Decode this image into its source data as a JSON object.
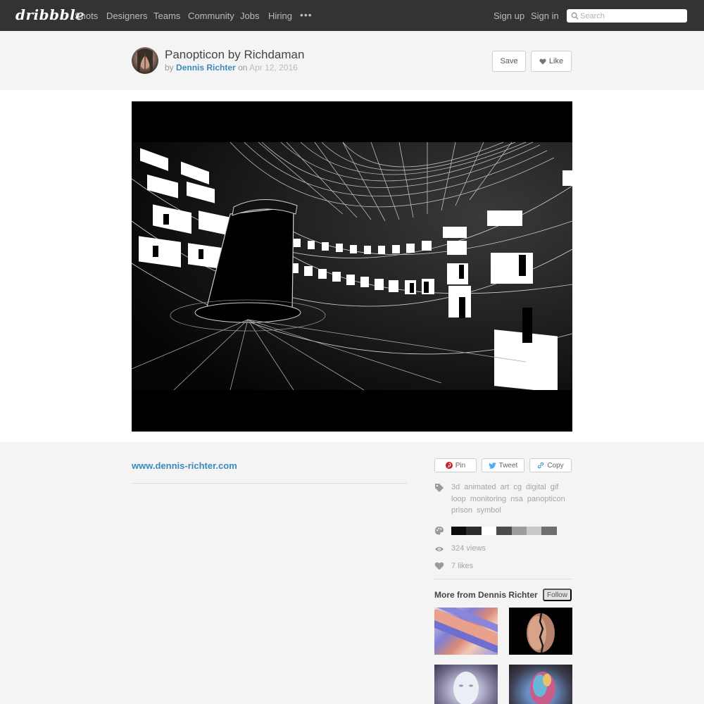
{
  "nav": {
    "logo": "dribbble",
    "items": [
      "Shots",
      "Designers",
      "Teams",
      "Community",
      "Jobs",
      "Hiring"
    ],
    "more": "•••",
    "sign_up": "Sign up",
    "sign_in": "Sign in",
    "search_placeholder": "Search"
  },
  "shot": {
    "title": "Panopticon by Richdaman",
    "by": "by",
    "author": "Dennis Richter",
    "on": "on",
    "date": "Apr 12, 2016",
    "save_label": "Save",
    "like_label": "Like"
  },
  "details": {
    "website": "www.dennis-richter.com",
    "share": {
      "pin": "Pin",
      "tweet": "Tweet",
      "copy": "Copy"
    },
    "tags": [
      "3d",
      "animated",
      "art",
      "cg",
      "digital",
      "gif",
      "loop",
      "monitoring",
      "nsa",
      "panopticon",
      "prison",
      "symbol"
    ],
    "palette": [
      "#0b0b0b",
      "#2c2c2c",
      "#ffffff",
      "#4b4b4b",
      "#9c9c9c",
      "#c8c8c8",
      "#6e6e6e"
    ],
    "views": "324 views",
    "likes": "7 likes"
  },
  "more": {
    "title": "More from Dennis Richter",
    "follow_label": "Follow"
  },
  "colors": {
    "nav_bg": "#333333",
    "link": "#3a8bbb",
    "muted": "#a5a5a5"
  }
}
